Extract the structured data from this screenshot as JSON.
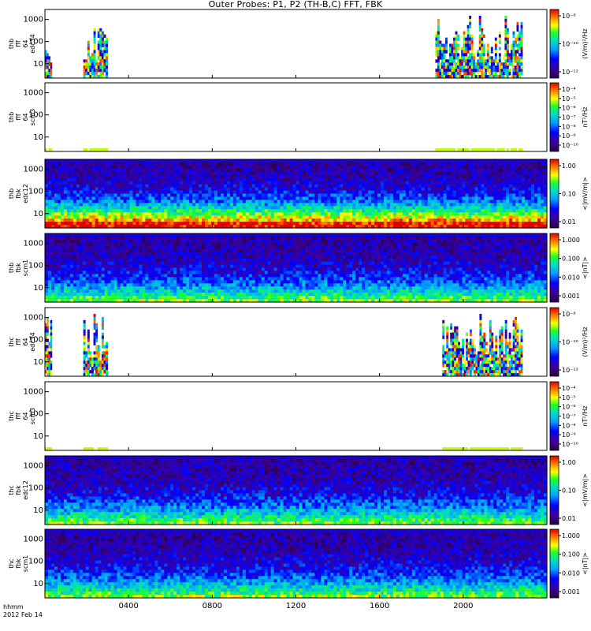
{
  "title": "Outer Probes: P1, P2 (TH-B,C) FFT, FBK",
  "footer": {
    "time_label": "hhmm",
    "date_label": "2012 Feb 14"
  },
  "colors": {
    "frame": "#000000",
    "background": "#ffffff"
  },
  "chart_data": [
    {
      "type": "heatmap",
      "panel": 1,
      "ylabel_lines": [
        "thb",
        "fff",
        "64",
        "edc34"
      ],
      "y_ticks": [
        "10",
        "100",
        "1000"
      ],
      "colorbar_ticks": [
        "10⁻⁸",
        "10⁻¹⁰",
        "10⁻¹²"
      ],
      "colorbar_label": "(V/m)²/Hz",
      "data_intervals_hhmm": [
        [
          "0000",
          "0020"
        ],
        [
          "0150",
          "0300"
        ],
        [
          "1840",
          "2250"
        ]
      ]
    },
    {
      "type": "heatmap",
      "panel": 2,
      "ylabel_lines": [
        "thb",
        "fff",
        "64",
        "scm3"
      ],
      "y_ticks": [
        "10",
        "100",
        "1000"
      ],
      "colorbar_ticks": [
        "10⁻⁴",
        "10⁻⁵",
        "10⁻⁶",
        "10⁻⁷",
        "10⁻⁸",
        "10⁻⁹",
        "10⁻¹⁰"
      ],
      "colorbar_label": "nT²/Hz",
      "data_intervals_hhmm": [
        [
          "0000",
          "0020"
        ],
        [
          "0150",
          "0300"
        ],
        [
          "1840",
          "2250"
        ]
      ]
    },
    {
      "type": "heatmap",
      "panel": 3,
      "ylabel_lines": [
        "thb",
        "fbk",
        "edc12"
      ],
      "y_ticks": [
        "10",
        "100",
        "1000"
      ],
      "colorbar_ticks": [
        "1.00",
        "0.10",
        "0.01"
      ],
      "colorbar_label": "<|mV/m|>",
      "data_intervals_hhmm": [
        [
          "0000",
          "2400"
        ]
      ]
    },
    {
      "type": "heatmap",
      "panel": 4,
      "ylabel_lines": [
        "thb",
        "fbk",
        "scm1"
      ],
      "y_ticks": [
        "10",
        "100",
        "1000"
      ],
      "colorbar_ticks": [
        "1.000",
        "0.100",
        "0.010",
        "0.001"
      ],
      "colorbar_label": "<|nT|>",
      "data_intervals_hhmm": [
        [
          "0000",
          "2400"
        ]
      ]
    },
    {
      "type": "heatmap",
      "panel": 5,
      "ylabel_lines": [
        "thc",
        "fff",
        "64",
        "edc34"
      ],
      "y_ticks": [
        "10",
        "100",
        "1000"
      ],
      "colorbar_ticks": [
        "10⁻⁸",
        "10⁻¹⁰",
        "10⁻¹²"
      ],
      "colorbar_label": "(V/m)²/Hz",
      "data_intervals_hhmm": [
        [
          "0000",
          "0020"
        ],
        [
          "0150",
          "0300"
        ],
        [
          "1900",
          "2250"
        ]
      ]
    },
    {
      "type": "heatmap",
      "panel": 6,
      "ylabel_lines": [
        "thc",
        "fff",
        "64",
        "scm3"
      ],
      "y_ticks": [
        "10",
        "100",
        "1000"
      ],
      "colorbar_ticks": [
        "10⁻⁴",
        "10⁻⁵",
        "10⁻⁶",
        "10⁻⁷",
        "10⁻⁸",
        "10⁻⁹",
        "10⁻¹⁰"
      ],
      "colorbar_label": "nT²/Hz",
      "data_intervals_hhmm": [
        [
          "0000",
          "0020"
        ],
        [
          "0150",
          "0300"
        ],
        [
          "1900",
          "2250"
        ]
      ]
    },
    {
      "type": "heatmap",
      "panel": 7,
      "ylabel_lines": [
        "thc",
        "fbk",
        "edc12"
      ],
      "y_ticks": [
        "10",
        "100",
        "1000"
      ],
      "colorbar_ticks": [
        "1.00",
        "0.10",
        "0.01"
      ],
      "colorbar_label": "<|mV/m|>",
      "data_intervals_hhmm": [
        [
          "0000",
          "2400"
        ]
      ]
    },
    {
      "type": "heatmap",
      "panel": 8,
      "ylabel_lines": [
        "thc",
        "fbk",
        "scm1"
      ],
      "y_ticks": [
        "10",
        "100",
        "1000"
      ],
      "colorbar_ticks": [
        "1.000",
        "0.100",
        "0.010",
        "0.001"
      ],
      "colorbar_label": "<|nT|>",
      "data_intervals_hhmm": [
        [
          "0000",
          "2400"
        ]
      ]
    }
  ],
  "x_axis": {
    "tick_labels": [
      "0400",
      "0800",
      "1200",
      "1600",
      "2000"
    ],
    "range_hhmm": [
      "0000",
      "2400"
    ]
  }
}
